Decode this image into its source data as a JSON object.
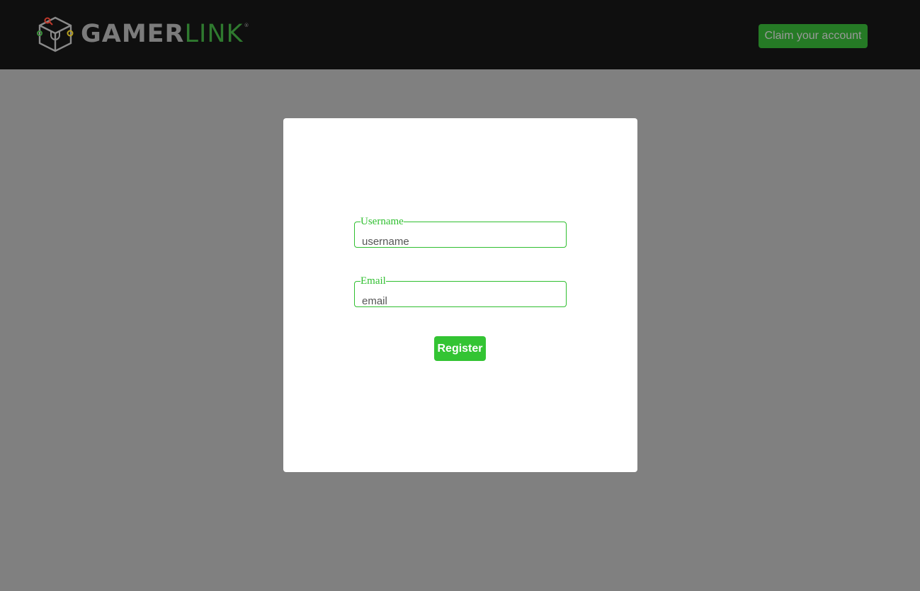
{
  "brand": {
    "name_part1": "GAMER",
    "name_part2": "LINK",
    "trademark": "®",
    "colors": {
      "gamer": "#7b7b7b",
      "link": "#2f7a2f"
    }
  },
  "header": {
    "claim_button_label": "Claim your account"
  },
  "form": {
    "username": {
      "label": "Username",
      "placeholder": "username",
      "value": ""
    },
    "email": {
      "label": "Email",
      "placeholder": "email",
      "value": ""
    },
    "submit_label": "Register"
  },
  "theme": {
    "accent": "#33c433",
    "header_bg": "#0f0f0f",
    "overlay_bg": "#808080",
    "claim_button_bg": "#257a25"
  }
}
